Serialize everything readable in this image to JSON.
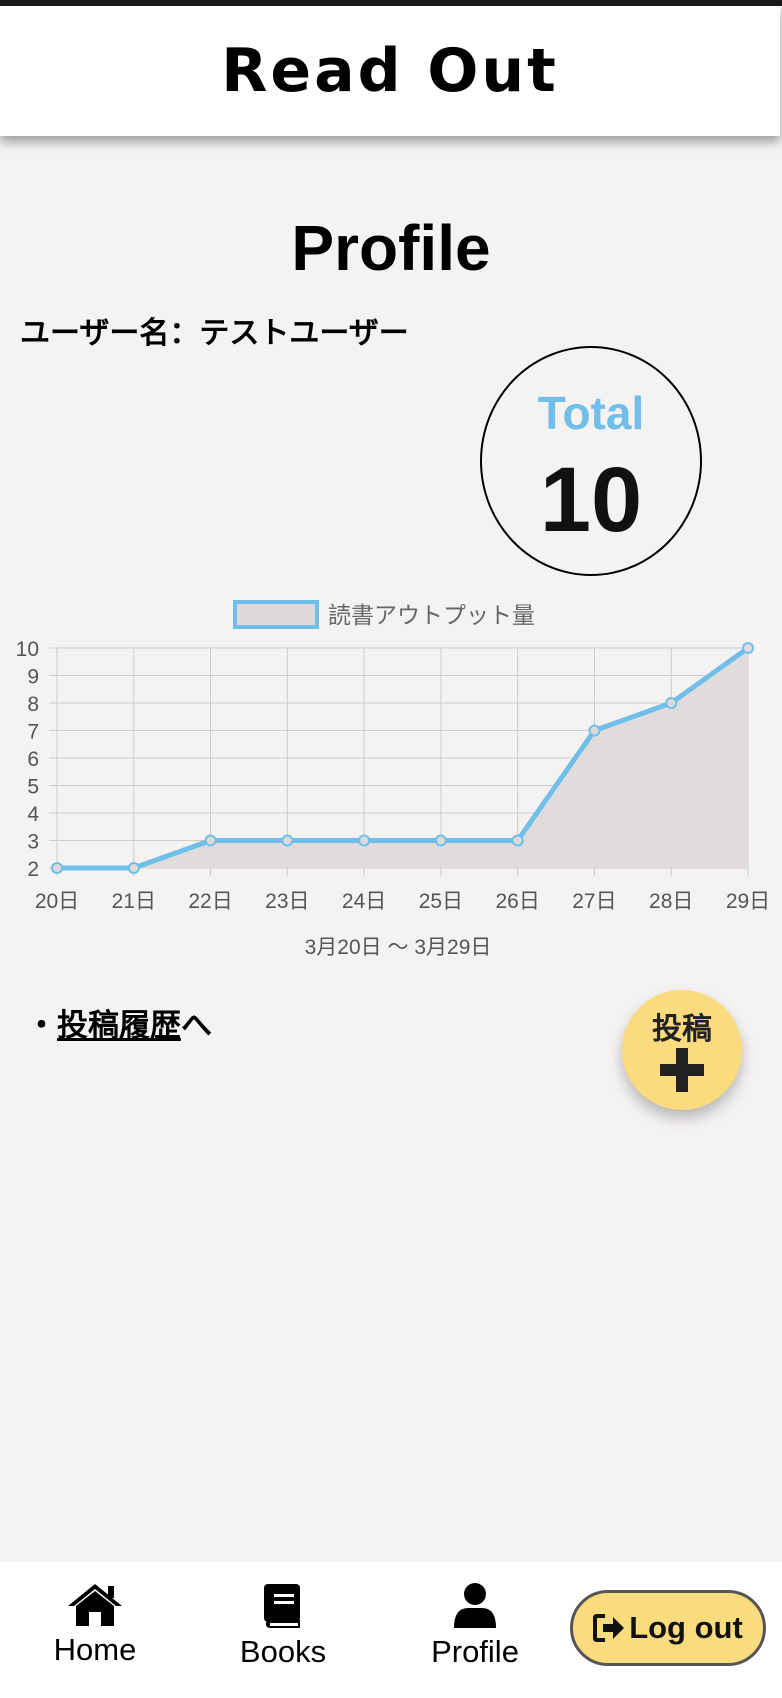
{
  "app": {
    "title": "Read Out"
  },
  "page": {
    "title": "Profile"
  },
  "user": {
    "label": "ユーザー名：テストユーザー"
  },
  "total": {
    "label": "Total",
    "value": "10"
  },
  "chart_data": {
    "type": "line",
    "x": [
      "20日",
      "21日",
      "22日",
      "23日",
      "24日",
      "25日",
      "26日",
      "27日",
      "28日",
      "29日"
    ],
    "series": [
      {
        "name": "読書アウトプット量",
        "values": [
          2,
          2,
          3,
          3,
          3,
          3,
          3,
          7,
          8,
          10
        ]
      }
    ],
    "xlabel": "3月20日 〜 3月29日",
    "ylabel": "",
    "ylim": [
      2,
      10
    ],
    "yticks": [
      2,
      3,
      4,
      5,
      6,
      7,
      8,
      9,
      10
    ],
    "grid": true,
    "legend": "top-center",
    "fill": true,
    "line_color": "#6fbfea",
    "fill_color": "#dedada"
  },
  "history": {
    "bullet": "・",
    "link_text": "投稿履歴",
    "suffix": "へ"
  },
  "post_button": {
    "label": "投稿",
    "icon": "plus-icon"
  },
  "nav": {
    "items": [
      {
        "label": "Home",
        "icon": "home-icon"
      },
      {
        "label": "Books",
        "icon": "book-icon"
      },
      {
        "label": "Profile",
        "icon": "user-icon"
      }
    ],
    "logout": {
      "label": "Log out",
      "icon": "sign-out-icon"
    }
  },
  "colors": {
    "accent": "#6fbfea",
    "button": "#fadb7e",
    "background": "#f5f2f2"
  }
}
